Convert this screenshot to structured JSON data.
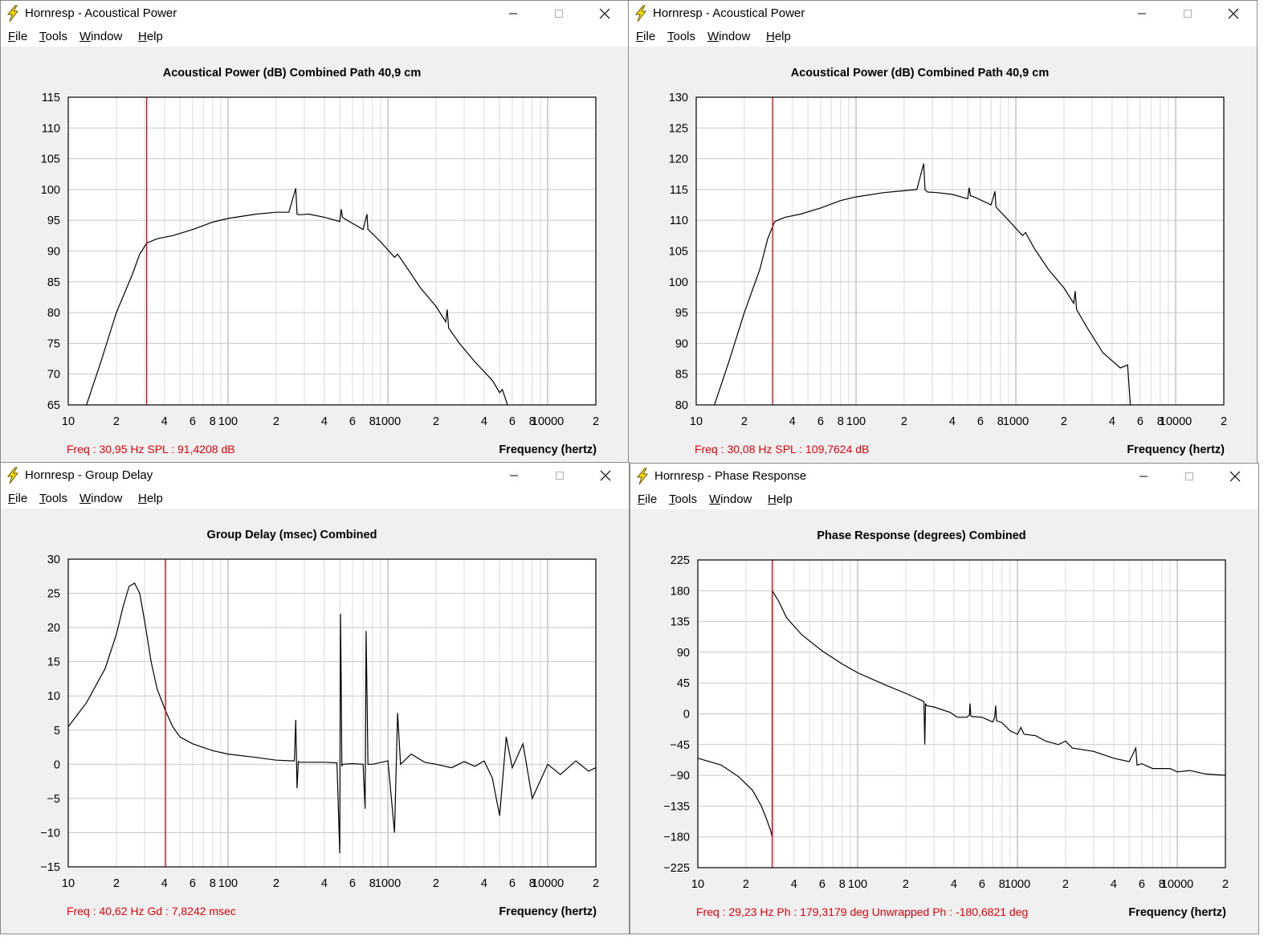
{
  "menu": [
    {
      "first": "F",
      "rest": "ile"
    },
    {
      "first": "T",
      "rest": "ools"
    },
    {
      "first": "W",
      "rest": "indow"
    },
    {
      "first": "H",
      "rest": "elp"
    }
  ],
  "xlabel": "Frequency (hertz)",
  "xticks": [
    {
      "f": 10,
      "label": "10"
    },
    {
      "f": 20,
      "label": "2"
    },
    {
      "f": 40,
      "label": "4"
    },
    {
      "f": 60,
      "label": "6"
    },
    {
      "f": 80,
      "label": "8"
    },
    {
      "f": 100,
      "label": "100"
    },
    {
      "f": 200,
      "label": "2"
    },
    {
      "f": 400,
      "label": "4"
    },
    {
      "f": 600,
      "label": "6"
    },
    {
      "f": 800,
      "label": "8"
    },
    {
      "f": 1000,
      "label": "1000"
    },
    {
      "f": 2000,
      "label": "2"
    },
    {
      "f": 4000,
      "label": "4"
    },
    {
      "f": 6000,
      "label": "6"
    },
    {
      "f": 8000,
      "label": "8"
    },
    {
      "f": 10000,
      "label": "10000"
    },
    {
      "f": 20000,
      "label": "2"
    }
  ],
  "colors": {
    "trace": "#000000",
    "cursor": "#e8000b",
    "grid": "#c8c8c8"
  },
  "windows": [
    {
      "title": "Hornresp - Acoustical Power",
      "chart_data": {
        "type": "line",
        "title": "Acoustical Power (dB)   Combined   Path 40,9 cm",
        "xlim": [
          10,
          20000
        ],
        "xscale": "log",
        "ylim": [
          65,
          115
        ],
        "yticks": [
          "115",
          "110",
          "105",
          "100",
          "95",
          "90",
          "85",
          "80",
          "75",
          "70",
          "65"
        ],
        "cursor_x": 30.95,
        "readout": "Freq : 30,95 Hz     SPL : 91,4208 dB",
        "x": [
          13,
          16,
          20,
          25,
          28,
          31,
          36,
          45,
          60,
          80,
          100,
          150,
          200,
          240,
          265,
          270,
          280,
          320,
          400,
          500,
          510,
          520,
          540,
          600,
          700,
          740,
          750,
          760,
          900,
          1100,
          1150,
          1300,
          1600,
          2000,
          2300,
          2350,
          2400,
          2800,
          3500,
          4500,
          5000,
          5200,
          5600
        ],
        "y": [
          65,
          72,
          80,
          86,
          89.5,
          91.3,
          92,
          92.5,
          93.5,
          94.7,
          95.3,
          96,
          96.3,
          96.3,
          100.2,
          96,
          95.9,
          96,
          95.5,
          94.8,
          96.8,
          95.5,
          95.2,
          94.5,
          93.5,
          96,
          93.5,
          93.4,
          91.5,
          89,
          89.5,
          87.5,
          84,
          81,
          78.5,
          80.5,
          77.5,
          75,
          72,
          69,
          67,
          67.5,
          65
        ]
      }
    },
    {
      "title": "Hornresp - Acoustical Power",
      "chart_data": {
        "type": "line",
        "title": "Acoustical Power (dB)   Combined   Path 40,9 cm",
        "xlim": [
          10,
          20000
        ],
        "xscale": "log",
        "ylim": [
          80,
          130
        ],
        "yticks": [
          "130",
          "125",
          "120",
          "115",
          "110",
          "105",
          "100",
          "95",
          "90",
          "85",
          "80"
        ],
        "cursor_x": 30.08,
        "readout": "Freq : 30,08 Hz     SPL : 109,7624 dB",
        "x": [
          13,
          16,
          20,
          25,
          28,
          31,
          36,
          45,
          60,
          80,
          100,
          150,
          200,
          240,
          265,
          270,
          280,
          320,
          400,
          500,
          510,
          520,
          560,
          700,
          740,
          750,
          760,
          900,
          1100,
          1150,
          1300,
          1600,
          2000,
          2300,
          2350,
          2400,
          2800,
          3500,
          4500,
          5000,
          5200,
          6500
        ],
        "y": [
          80,
          87,
          95,
          102,
          107,
          109.8,
          110.5,
          111,
          112,
          113.2,
          113.8,
          114.5,
          114.8,
          115,
          119.2,
          115,
          114.6,
          114.5,
          114.2,
          113.5,
          115.3,
          114,
          113.7,
          112.5,
          114.7,
          112.3,
          112,
          110,
          107.5,
          108,
          105.5,
          102,
          99,
          96.5,
          98.5,
          95.5,
          92.5,
          88.5,
          86,
          86.5,
          80
        ]
      }
    },
    {
      "title": "Hornresp - Group Delay",
      "chart_data": {
        "type": "line",
        "title": "Group Delay (msec)   Combined",
        "xlim": [
          10,
          20000
        ],
        "xscale": "log",
        "ylim": [
          -15,
          30
        ],
        "yticks": [
          "30",
          "25",
          "20",
          "15",
          "10",
          "5",
          "0",
          "−5",
          "−10",
          "−15"
        ],
        "cursor_x": 40.62,
        "readout": "Freq : 40,62 Hz     Gd : 7,8242 msec",
        "x": [
          10,
          13,
          17,
          20,
          22,
          24,
          26,
          28,
          30,
          33,
          36,
          40.62,
          45,
          50,
          60,
          80,
          100,
          150,
          200,
          260,
          265,
          270,
          275,
          280,
          300,
          400,
          480,
          500,
          505,
          510,
          515,
          520,
          600,
          700,
          720,
          730,
          740,
          750,
          800,
          1000,
          1100,
          1150,
          1200,
          1400,
          1700,
          2000,
          2500,
          3000,
          3500,
          4000,
          4500,
          5000,
          5500,
          6000,
          7000,
          8000,
          10000,
          12000,
          15000,
          18000,
          20000
        ],
        "y": [
          5.5,
          9,
          14,
          19,
          23,
          26,
          26.5,
          25,
          21,
          15,
          11,
          7.8,
          5.5,
          4,
          3,
          2,
          1.5,
          1,
          0.6,
          0.5,
          6.5,
          -3.5,
          0.4,
          0.3,
          0.3,
          0.3,
          0.2,
          -13,
          22,
          12,
          -0.3,
          0,
          0.1,
          0,
          -6.5,
          19.5,
          10.5,
          0,
          0,
          0.5,
          -10,
          7.5,
          0,
          1.5,
          0.3,
          0,
          -0.5,
          0.4,
          -0.3,
          0.5,
          -2,
          -7.5,
          4,
          -0.5,
          3,
          -5,
          0,
          -1.5,
          0.5,
          -1,
          -0.5
        ]
      }
    },
    {
      "title": "Hornresp - Phase Response",
      "chart_data": {
        "type": "line",
        "title": "Phase Response (degrees)   Combined",
        "xlim": [
          10,
          20000
        ],
        "xscale": "log",
        "ylim": [
          -225,
          225
        ],
        "yticks": [
          "225",
          "180",
          "135",
          "90",
          "45",
          "0",
          "−45",
          "−90",
          "−135",
          "−180",
          "−225"
        ],
        "cursor_x": 29.23,
        "readout": "Freq : 29,23 Hz     Ph : 179,3179 deg     Unwrapped Ph : -180,6821 deg",
        "x": [
          10,
          14,
          18,
          22,
          25,
          27,
          28.5,
          29.23,
          29.24,
          32,
          36,
          45,
          60,
          80,
          100,
          150,
          200,
          260,
          263,
          266,
          270,
          300,
          380,
          420,
          480,
          500,
          505,
          510,
          520,
          600,
          700,
          720,
          730,
          740,
          800,
          900,
          1000,
          1050,
          1100,
          1300,
          1500,
          1800,
          2000,
          2200,
          3000,
          4000,
          5000,
          5500,
          5600,
          6000,
          7000,
          9000,
          10000,
          12000,
          15000,
          20000
        ],
        "y": [
          -65,
          -75,
          -92,
          -112,
          -135,
          -155,
          -170,
          -180,
          180,
          165,
          140,
          115,
          92,
          73,
          60,
          42,
          30,
          18,
          -45,
          15,
          12,
          10,
          2,
          -5,
          -5,
          -2,
          15,
          -3,
          -4,
          -5,
          -12,
          -5,
          12,
          -10,
          -13,
          -25,
          -30,
          -20,
          -30,
          -32,
          -40,
          -45,
          -40,
          -50,
          -55,
          -65,
          -70,
          -50,
          -75,
          -73,
          -80,
          -80,
          -85,
          -83,
          -88,
          -90
        ]
      }
    }
  ]
}
